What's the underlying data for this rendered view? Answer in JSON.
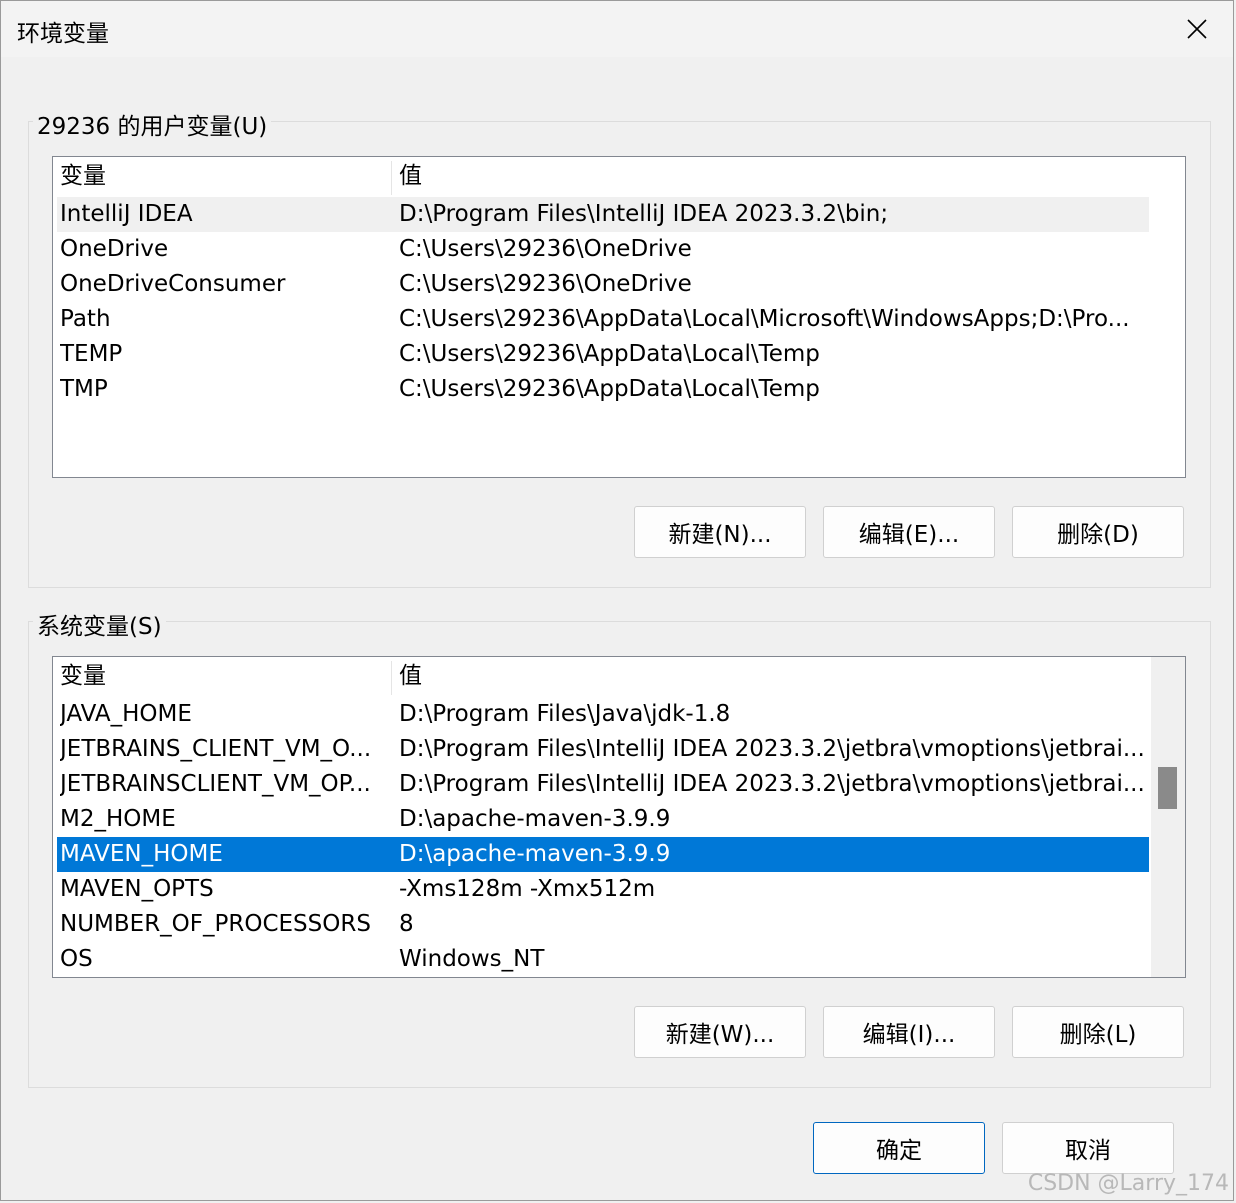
{
  "window": {
    "title": "环境变量"
  },
  "user_group": {
    "label": "29236 的用户变量(U)",
    "columns": [
      "变量",
      "值"
    ],
    "rows": [
      {
        "name": "IntelliJ IDEA",
        "value": "D:\\Program Files\\IntelliJ IDEA 2023.3.2\\bin;"
      },
      {
        "name": "OneDrive",
        "value": "C:\\Users\\29236\\OneDrive"
      },
      {
        "name": "OneDriveConsumer",
        "value": "C:\\Users\\29236\\OneDrive"
      },
      {
        "name": "Path",
        "value": "C:\\Users\\29236\\AppData\\Local\\Microsoft\\WindowsApps;D:\\Pro..."
      },
      {
        "name": "TEMP",
        "value": "C:\\Users\\29236\\AppData\\Local\\Temp"
      },
      {
        "name": "TMP",
        "value": "C:\\Users\\29236\\AppData\\Local\\Temp"
      }
    ],
    "buttons": {
      "new": "新建(N)...",
      "edit": "编辑(E)...",
      "delete": "删除(D)"
    }
  },
  "system_group": {
    "label": "系统变量(S)",
    "columns": [
      "变量",
      "值"
    ],
    "rows": [
      {
        "name": "JAVA_HOME",
        "value": "D:\\Program Files\\Java\\jdk-1.8"
      },
      {
        "name": "JETBRAINS_CLIENT_VM_O...",
        "value": "D:\\Program Files\\IntelliJ IDEA 2023.3.2\\jetbra\\vmoptions\\jetbrai..."
      },
      {
        "name": "JETBRAINSCLIENT_VM_OP...",
        "value": "D:\\Program Files\\IntelliJ IDEA 2023.3.2\\jetbra\\vmoptions\\jetbrai..."
      },
      {
        "name": "M2_HOME",
        "value": "D:\\apache-maven-3.9.9"
      },
      {
        "name": "MAVEN_HOME",
        "value": "D:\\apache-maven-3.9.9"
      },
      {
        "name": "MAVEN_OPTS",
        "value": "-Xms128m -Xmx512m"
      },
      {
        "name": "NUMBER_OF_PROCESSORS",
        "value": "8"
      },
      {
        "name": "OS",
        "value": "Windows_NT"
      }
    ],
    "buttons": {
      "new": "新建(W)...",
      "edit": "编辑(I)...",
      "delete": "删除(L)"
    }
  },
  "footer": {
    "ok": "确定",
    "cancel": "取消"
  },
  "watermark": "CSDN @Larry_174",
  "icons": {
    "close": "close-icon"
  },
  "colors": {
    "selection": "#0078d7",
    "primary_border": "#0067c0"
  }
}
